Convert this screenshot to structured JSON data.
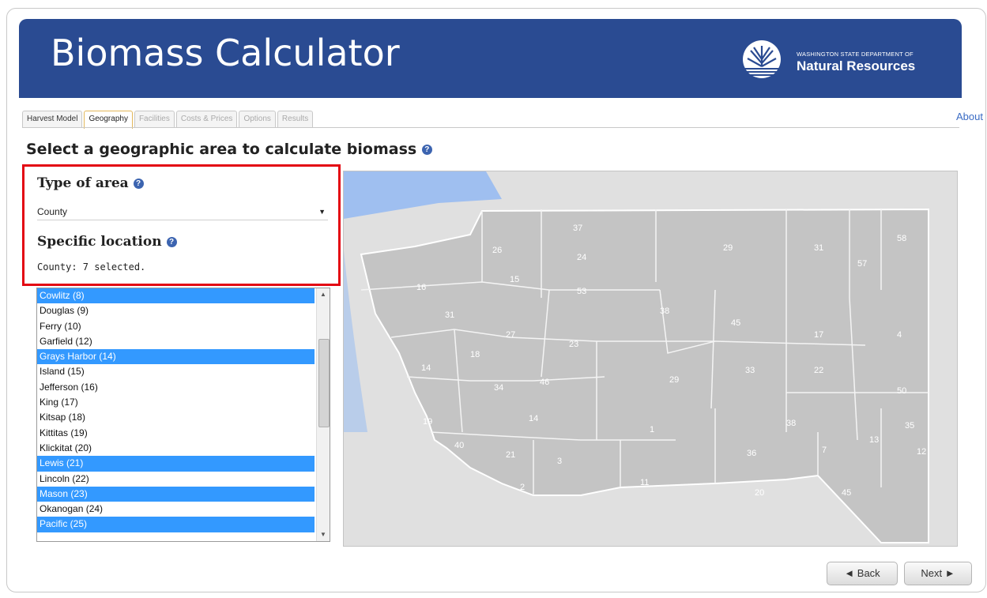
{
  "app": {
    "title": "Biomass Calculator",
    "agency_line1": "WASHINGTON STATE DEPARTMENT OF",
    "agency_line2": "Natural Resources"
  },
  "tabs": [
    {
      "label": "Harvest Model",
      "state": "normal"
    },
    {
      "label": "Geography",
      "state": "active"
    },
    {
      "label": "Facilities",
      "state": "disabled"
    },
    {
      "label": "Costs & Prices",
      "state": "disabled"
    },
    {
      "label": "Options",
      "state": "disabled"
    },
    {
      "label": "Results",
      "state": "disabled"
    }
  ],
  "about_link": "About",
  "page_heading": "Select a geographic area to calculate biomass",
  "area_type": {
    "label": "Type of area",
    "selected": "County"
  },
  "location": {
    "label": "Specific location",
    "selection_summary": "County: 7 selected.",
    "items": [
      {
        "label": "Cowlitz (8)",
        "selected": true
      },
      {
        "label": "Douglas (9)",
        "selected": false
      },
      {
        "label": "Ferry (10)",
        "selected": false
      },
      {
        "label": "Garfield (12)",
        "selected": false
      },
      {
        "label": "Grays Harbor (14)",
        "selected": true
      },
      {
        "label": "Island (15)",
        "selected": false
      },
      {
        "label": "Jefferson (16)",
        "selected": false
      },
      {
        "label": "King (17)",
        "selected": false
      },
      {
        "label": "Kitsap (18)",
        "selected": false
      },
      {
        "label": "Kittitas (19)",
        "selected": false
      },
      {
        "label": "Klickitat (20)",
        "selected": false
      },
      {
        "label": "Lewis (21)",
        "selected": true
      },
      {
        "label": "Lincoln (22)",
        "selected": false
      },
      {
        "label": "Mason (23)",
        "selected": true
      },
      {
        "label": "Okanogan (24)",
        "selected": false
      },
      {
        "label": "Pacific (25)",
        "selected": true
      }
    ]
  },
  "map": {
    "county_numbers": [
      "37",
      "29",
      "31",
      "57",
      "58",
      "26",
      "24",
      "16",
      "15",
      "53",
      "31",
      "27",
      "38",
      "45",
      "18",
      "14",
      "23",
      "17",
      "4",
      "22",
      "33",
      "34",
      "46",
      "29",
      "50",
      "19",
      "14",
      "1",
      "38",
      "40",
      "13",
      "35",
      "21",
      "3",
      "36",
      "7",
      "12",
      "2",
      "11",
      "45",
      "20"
    ]
  },
  "buttons": {
    "back": "◄ Back",
    "next": "Next ►"
  },
  "colors": {
    "banner": "#2a4b92",
    "selection": "#3399ff",
    "highlight_box": "#e30613",
    "water": "#9fbff0",
    "land": "#c4c4c4"
  }
}
